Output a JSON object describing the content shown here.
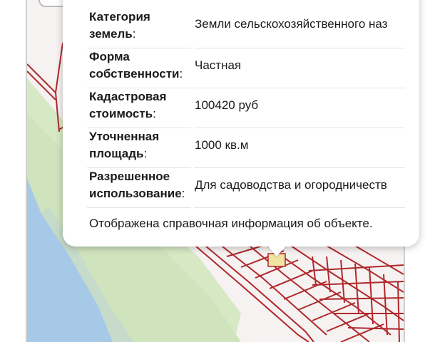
{
  "popup": {
    "rows": [
      {
        "label": "Категория земель",
        "label_line1": "Категория",
        "label_line2": "земель",
        "value": "Земли сельскохозяйственного наз"
      },
      {
        "label": "Форма собственности",
        "label_line1": "Форма",
        "label_line2": "собственности",
        "value": "Частная"
      },
      {
        "label": "Кадастровая стоимость",
        "label_line1": "Кадастровая",
        "label_line2": "стоимость",
        "value": "100420 руб"
      },
      {
        "label": "Уточненная площадь",
        "label_line1": "Уточненная",
        "label_line2": "площадь",
        "value": "1000 кв.м"
      },
      {
        "label": "Разрешенное использование",
        "label_line1": "Разрешенное",
        "label_line2": "использование",
        "value": "Для садоводства и огородничеств"
      }
    ],
    "colon": ":",
    "footer_note": "Отображена справочная информация об объекте."
  },
  "map": {
    "parcel_line_color": "#b0282b",
    "green_color": "#d6e8c4",
    "water_color": "#a7c9e8",
    "background_color": "#f6f2f2",
    "highlight_color": "#f2e3a0"
  }
}
